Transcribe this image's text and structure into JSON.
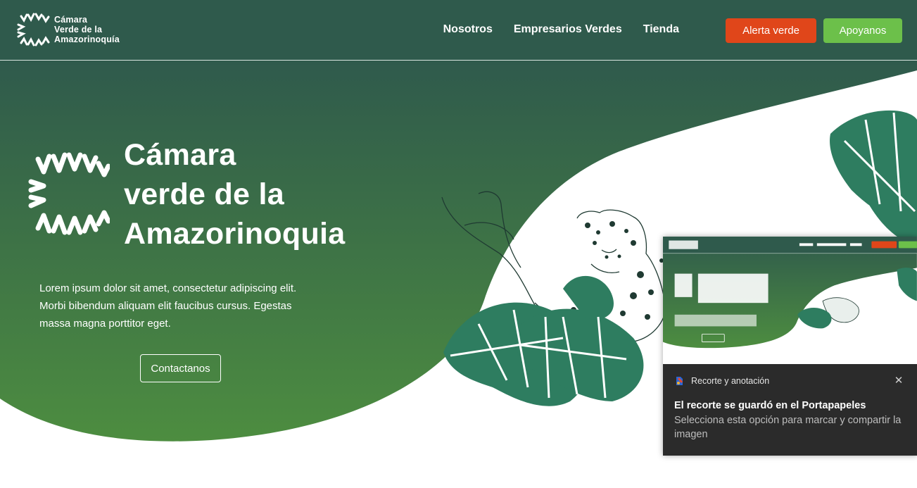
{
  "nav": {
    "logo_lines": [
      "Cámara",
      "Verde de la",
      "Amazorinoquía"
    ],
    "links": [
      "Nosotros",
      "Empresarios Verdes",
      "Tienda"
    ],
    "alert_label": "Alerta verde",
    "support_label": "Apoyanos"
  },
  "hero": {
    "title_lines": [
      "Cámara",
      "verde de la",
      "Amazorinoquia"
    ],
    "description_lines": [
      "Lorem ipsum dolor sit amet, consectetur adipiscing elit.",
      "Morbi bibendum aliquam elit faucibus cursus. Egestas",
      "massa magna porttitor eget."
    ],
    "contact_label": "Contactanos"
  },
  "toast": {
    "app_name": "Recorte y anotación",
    "close_icon": "close-icon",
    "title": "El recorte se guardó en el Portapapeles",
    "body": "Selecciona esta opción para marcar y compartir la imagen"
  },
  "colors": {
    "nav_bg": "#2f5a4c",
    "hero_top": "#2f5a4c",
    "hero_bottom": "#4a8c3f",
    "alert": "#e0461a",
    "support": "#6cc04a",
    "leaf": "#2e7d60",
    "toast_bg": "#2b2b2b"
  }
}
